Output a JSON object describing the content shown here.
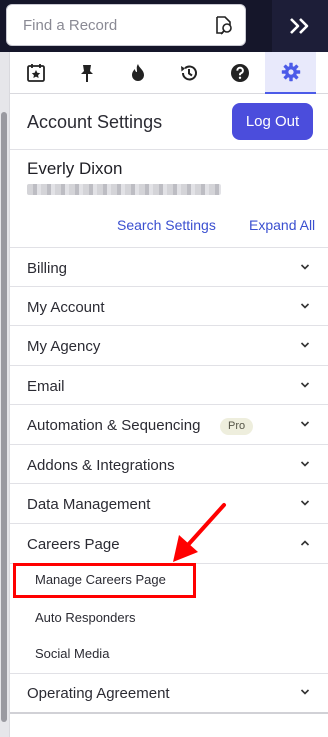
{
  "search": {
    "placeholder": "Find a Record"
  },
  "tabs": [
    {
      "icon": "calendar-star-icon"
    },
    {
      "icon": "pin-icon"
    },
    {
      "icon": "fire-icon"
    },
    {
      "icon": "history-icon"
    },
    {
      "icon": "help-icon"
    },
    {
      "icon": "gear-icon",
      "active": true
    }
  ],
  "header": {
    "title": "Account Settings",
    "logout_label": "Log Out"
  },
  "user": {
    "name": "Everly Dixon"
  },
  "links": {
    "search_settings": "Search Settings",
    "expand_all": "Expand All"
  },
  "menu": {
    "billing": "Billing",
    "my_account": "My Account",
    "my_agency": "My Agency",
    "email": "Email",
    "automation": "Automation & Sequencing",
    "automation_badge": "Pro",
    "addons": "Addons & Integrations",
    "data_management": "Data Management",
    "careers_page": "Careers Page",
    "careers_sub": [
      "Manage Careers Page",
      "Auto Responders",
      "Social Media"
    ],
    "operating_agreement": "Operating Agreement"
  },
  "colors": {
    "accent": "#4b4ddc",
    "link": "#3a4fd0",
    "annotation": "#ff0000",
    "topbar": "#15162a"
  }
}
